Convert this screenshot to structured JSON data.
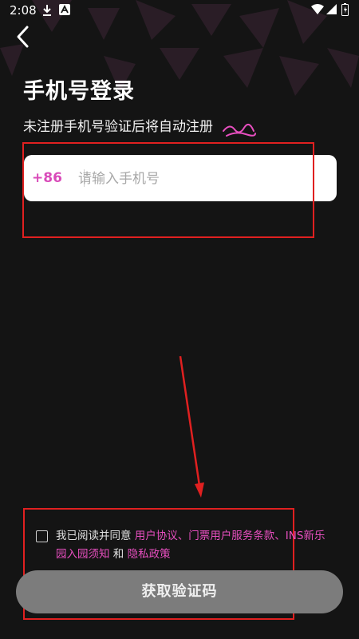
{
  "status_bar": {
    "time": "2:08",
    "icons": [
      "download-icon",
      "accessibility-icon",
      "wifi-icon",
      "signal-icon",
      "battery-icon"
    ]
  },
  "header": {
    "back_icon": "chevron-left-icon"
  },
  "title": "手机号登录",
  "subtitle": "未注册手机号验证后将自动注册",
  "phone": {
    "country_code": "+86",
    "placeholder": "请输入手机号",
    "value": ""
  },
  "agreement": {
    "checked": false,
    "prefix": "我已阅读并同意 ",
    "link1": "用户协议、门票用户服务条款、INS新乐园入园须知",
    "and": " 和 ",
    "link2": "隐私政策"
  },
  "submit_button": "获取验证码",
  "colors": {
    "accent": "#e84fc0",
    "background": "#141414",
    "button": "#7c7c7c",
    "annotation_red": "#e02020"
  }
}
